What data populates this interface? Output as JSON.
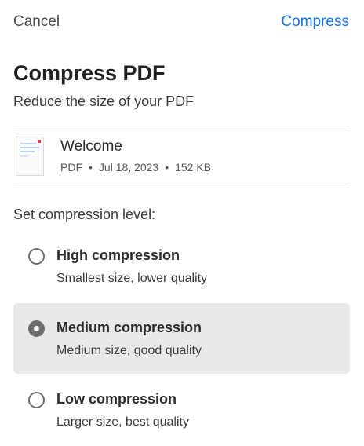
{
  "header": {
    "cancel_label": "Cancel",
    "compress_label": "Compress",
    "accent_color": "#1473e6"
  },
  "title": "Compress PDF",
  "subtitle": "Reduce the size of your PDF",
  "file": {
    "name": "Welcome",
    "type": "PDF",
    "date": "Jul 18, 2023",
    "size": "152 KB",
    "separator": "•",
    "thumbnail_icon": "pdf-thumbnail"
  },
  "compression": {
    "label": "Set compression level:",
    "options": [
      {
        "title": "High compression",
        "description": "Smallest size, lower quality",
        "selected": false
      },
      {
        "title": "Medium compression",
        "description": "Medium size, good quality",
        "selected": true
      },
      {
        "title": "Low compression",
        "description": "Larger size, best quality",
        "selected": false
      }
    ]
  }
}
